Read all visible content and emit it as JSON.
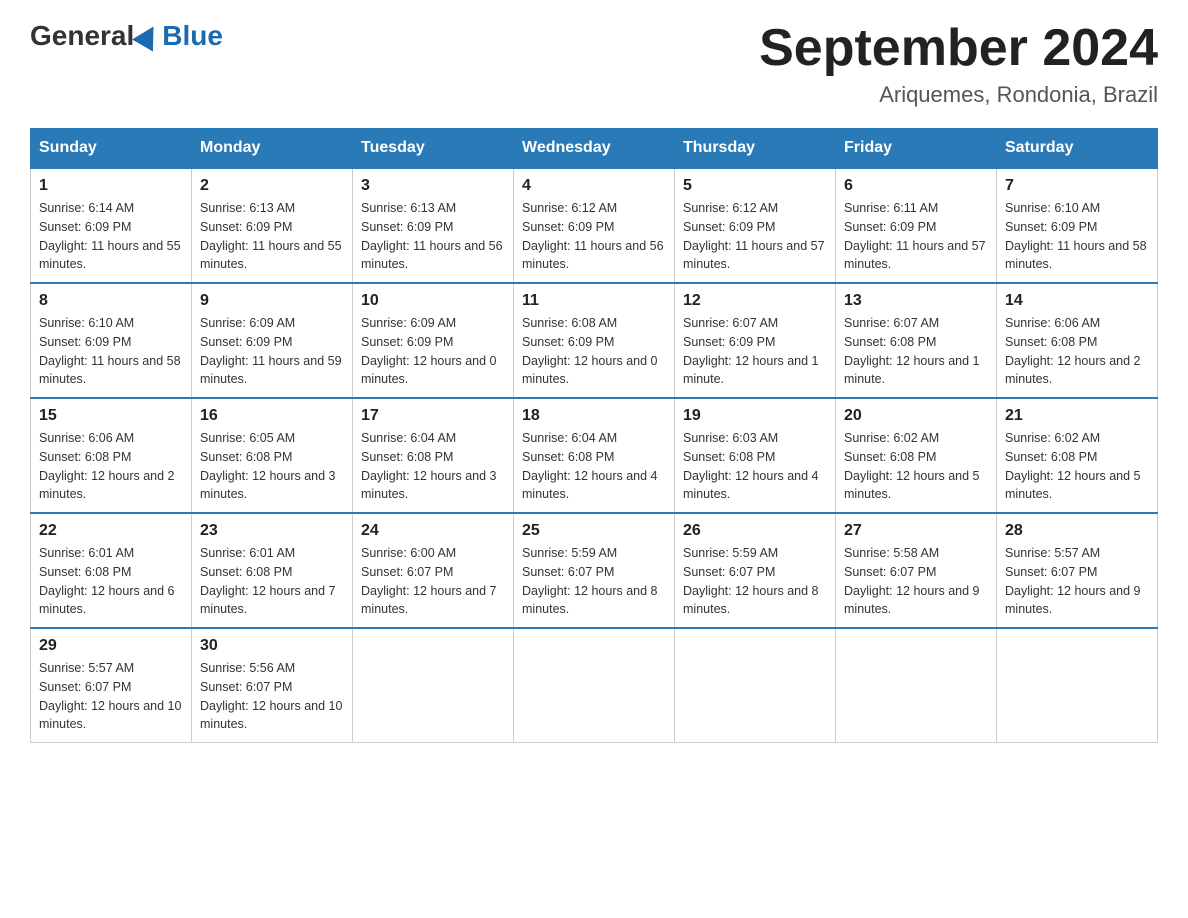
{
  "header": {
    "logo_general": "General",
    "logo_blue": "Blue",
    "title": "September 2024",
    "subtitle": "Ariquemes, Rondonia, Brazil"
  },
  "days_of_week": [
    "Sunday",
    "Monday",
    "Tuesday",
    "Wednesday",
    "Thursday",
    "Friday",
    "Saturday"
  ],
  "weeks": [
    [
      {
        "day": "1",
        "sunrise": "6:14 AM",
        "sunset": "6:09 PM",
        "daylight": "11 hours and 55 minutes."
      },
      {
        "day": "2",
        "sunrise": "6:13 AM",
        "sunset": "6:09 PM",
        "daylight": "11 hours and 55 minutes."
      },
      {
        "day": "3",
        "sunrise": "6:13 AM",
        "sunset": "6:09 PM",
        "daylight": "11 hours and 56 minutes."
      },
      {
        "day": "4",
        "sunrise": "6:12 AM",
        "sunset": "6:09 PM",
        "daylight": "11 hours and 56 minutes."
      },
      {
        "day": "5",
        "sunrise": "6:12 AM",
        "sunset": "6:09 PM",
        "daylight": "11 hours and 57 minutes."
      },
      {
        "day": "6",
        "sunrise": "6:11 AM",
        "sunset": "6:09 PM",
        "daylight": "11 hours and 57 minutes."
      },
      {
        "day": "7",
        "sunrise": "6:10 AM",
        "sunset": "6:09 PM",
        "daylight": "11 hours and 58 minutes."
      }
    ],
    [
      {
        "day": "8",
        "sunrise": "6:10 AM",
        "sunset": "6:09 PM",
        "daylight": "11 hours and 58 minutes."
      },
      {
        "day": "9",
        "sunrise": "6:09 AM",
        "sunset": "6:09 PM",
        "daylight": "11 hours and 59 minutes."
      },
      {
        "day": "10",
        "sunrise": "6:09 AM",
        "sunset": "6:09 PM",
        "daylight": "12 hours and 0 minutes."
      },
      {
        "day": "11",
        "sunrise": "6:08 AM",
        "sunset": "6:09 PM",
        "daylight": "12 hours and 0 minutes."
      },
      {
        "day": "12",
        "sunrise": "6:07 AM",
        "sunset": "6:09 PM",
        "daylight": "12 hours and 1 minute."
      },
      {
        "day": "13",
        "sunrise": "6:07 AM",
        "sunset": "6:08 PM",
        "daylight": "12 hours and 1 minute."
      },
      {
        "day": "14",
        "sunrise": "6:06 AM",
        "sunset": "6:08 PM",
        "daylight": "12 hours and 2 minutes."
      }
    ],
    [
      {
        "day": "15",
        "sunrise": "6:06 AM",
        "sunset": "6:08 PM",
        "daylight": "12 hours and 2 minutes."
      },
      {
        "day": "16",
        "sunrise": "6:05 AM",
        "sunset": "6:08 PM",
        "daylight": "12 hours and 3 minutes."
      },
      {
        "day": "17",
        "sunrise": "6:04 AM",
        "sunset": "6:08 PM",
        "daylight": "12 hours and 3 minutes."
      },
      {
        "day": "18",
        "sunrise": "6:04 AM",
        "sunset": "6:08 PM",
        "daylight": "12 hours and 4 minutes."
      },
      {
        "day": "19",
        "sunrise": "6:03 AM",
        "sunset": "6:08 PM",
        "daylight": "12 hours and 4 minutes."
      },
      {
        "day": "20",
        "sunrise": "6:02 AM",
        "sunset": "6:08 PM",
        "daylight": "12 hours and 5 minutes."
      },
      {
        "day": "21",
        "sunrise": "6:02 AM",
        "sunset": "6:08 PM",
        "daylight": "12 hours and 5 minutes."
      }
    ],
    [
      {
        "day": "22",
        "sunrise": "6:01 AM",
        "sunset": "6:08 PM",
        "daylight": "12 hours and 6 minutes."
      },
      {
        "day": "23",
        "sunrise": "6:01 AM",
        "sunset": "6:08 PM",
        "daylight": "12 hours and 7 minutes."
      },
      {
        "day": "24",
        "sunrise": "6:00 AM",
        "sunset": "6:07 PM",
        "daylight": "12 hours and 7 minutes."
      },
      {
        "day": "25",
        "sunrise": "5:59 AM",
        "sunset": "6:07 PM",
        "daylight": "12 hours and 8 minutes."
      },
      {
        "day": "26",
        "sunrise": "5:59 AM",
        "sunset": "6:07 PM",
        "daylight": "12 hours and 8 minutes."
      },
      {
        "day": "27",
        "sunrise": "5:58 AM",
        "sunset": "6:07 PM",
        "daylight": "12 hours and 9 minutes."
      },
      {
        "day": "28",
        "sunrise": "5:57 AM",
        "sunset": "6:07 PM",
        "daylight": "12 hours and 9 minutes."
      }
    ],
    [
      {
        "day": "29",
        "sunrise": "5:57 AM",
        "sunset": "6:07 PM",
        "daylight": "12 hours and 10 minutes."
      },
      {
        "day": "30",
        "sunrise": "5:56 AM",
        "sunset": "6:07 PM",
        "daylight": "12 hours and 10 minutes."
      },
      null,
      null,
      null,
      null,
      null
    ]
  ],
  "labels": {
    "sunrise": "Sunrise:",
    "sunset": "Sunset:",
    "daylight": "Daylight:"
  }
}
